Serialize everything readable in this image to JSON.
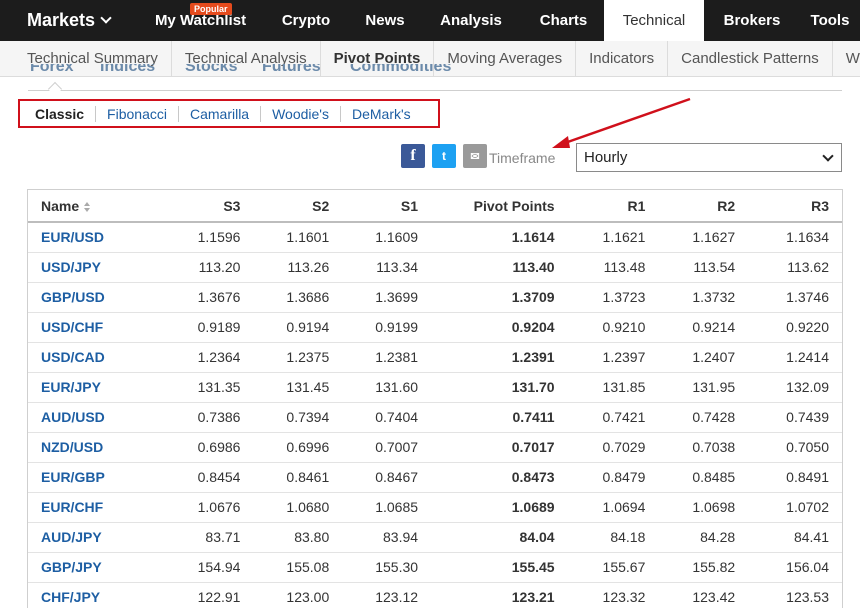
{
  "topnav": {
    "brand": "Markets",
    "items": [
      {
        "label": "My Watchlist",
        "badge": "Popular"
      },
      {
        "label": "Crypto"
      },
      {
        "label": "News"
      },
      {
        "label": "Analysis"
      },
      {
        "label": "Charts"
      },
      {
        "label": "Technical",
        "active": true
      },
      {
        "label": "Brokers"
      },
      {
        "label": "Tools"
      }
    ]
  },
  "subnav": {
    "items": [
      "Technical Summary",
      "Technical Analysis",
      "Pivot Points",
      "Moving Averages",
      "Indicators",
      "Candlestick Patterns",
      "Webinars"
    ]
  },
  "asset_tabs": [
    "Forex",
    "Indices",
    "Stocks",
    "Futures",
    "Commodities"
  ],
  "methods": [
    "Classic",
    "Fibonacci",
    "Camarilla",
    "Woodie's",
    "DeMark's"
  ],
  "share": {
    "facebook": "f",
    "twitter": "t",
    "email": "✉"
  },
  "timeframe": {
    "label": "Timeframe",
    "selected": "Hourly"
  },
  "table": {
    "headers": [
      "Name",
      "S3",
      "S2",
      "S1",
      "Pivot Points",
      "R1",
      "R2",
      "R3"
    ],
    "rows": [
      [
        "EUR/USD",
        "1.1596",
        "1.1601",
        "1.1609",
        "1.1614",
        "1.1621",
        "1.1627",
        "1.1634"
      ],
      [
        "USD/JPY",
        "113.20",
        "113.26",
        "113.34",
        "113.40",
        "113.48",
        "113.54",
        "113.62"
      ],
      [
        "GBP/USD",
        "1.3676",
        "1.3686",
        "1.3699",
        "1.3709",
        "1.3723",
        "1.3732",
        "1.3746"
      ],
      [
        "USD/CHF",
        "0.9189",
        "0.9194",
        "0.9199",
        "0.9204",
        "0.9210",
        "0.9214",
        "0.9220"
      ],
      [
        "USD/CAD",
        "1.2364",
        "1.2375",
        "1.2381",
        "1.2391",
        "1.2397",
        "1.2407",
        "1.2414"
      ],
      [
        "EUR/JPY",
        "131.35",
        "131.45",
        "131.60",
        "131.70",
        "131.85",
        "131.95",
        "132.09"
      ],
      [
        "AUD/USD",
        "0.7386",
        "0.7394",
        "0.7404",
        "0.7411",
        "0.7421",
        "0.7428",
        "0.7439"
      ],
      [
        "NZD/USD",
        "0.6986",
        "0.6996",
        "0.7007",
        "0.7017",
        "0.7029",
        "0.7038",
        "0.7050"
      ],
      [
        "EUR/GBP",
        "0.8454",
        "0.8461",
        "0.8467",
        "0.8473",
        "0.8479",
        "0.8485",
        "0.8491"
      ],
      [
        "EUR/CHF",
        "1.0676",
        "1.0680",
        "1.0685",
        "1.0689",
        "1.0694",
        "1.0698",
        "1.0702"
      ],
      [
        "AUD/JPY",
        "83.71",
        "83.80",
        "83.94",
        "84.04",
        "84.18",
        "84.28",
        "84.41"
      ],
      [
        "GBP/JPY",
        "154.94",
        "155.08",
        "155.30",
        "155.45",
        "155.67",
        "155.82",
        "156.04"
      ],
      [
        "CHF/JPY",
        "122.91",
        "123.00",
        "123.12",
        "123.21",
        "123.32",
        "123.42",
        "123.53"
      ]
    ]
  },
  "colors": {
    "nav_bg": "#1c1c1c",
    "badge": "#e54b1d",
    "link": "#1d5ea3",
    "highlight_box": "#d0101b",
    "facebook": "#3b5998",
    "twitter": "#1da1f2"
  }
}
